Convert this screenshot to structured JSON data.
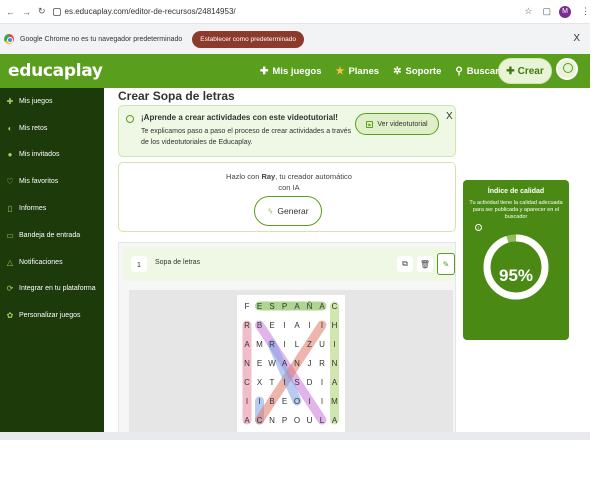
{
  "browser": {
    "url": "es.educaplay.com/editor-de-recursos/24814953/",
    "profile_initial": "M",
    "default_msg": "Google Chrome no es tu navegador predeterminado",
    "default_btn": "Establecer como predeterminado",
    "close": "X"
  },
  "header": {
    "logo": "educaplay",
    "nav": [
      {
        "label": "Mis juegos",
        "icon": "gamepad-icon"
      },
      {
        "label": "Planes",
        "icon": "star-icon"
      },
      {
        "label": "Soporte",
        "icon": "support-icon"
      },
      {
        "label": "Buscar juegos",
        "icon": "search-icon"
      }
    ],
    "create": "Crear"
  },
  "sidebar": {
    "items": [
      {
        "label": "Mis juegos",
        "icon": "gamepad-icon"
      },
      {
        "label": "Mis retos",
        "icon": "trophy-icon"
      },
      {
        "label": "Mis invitados",
        "icon": "users-icon"
      },
      {
        "label": "Mis favoritos",
        "icon": "heart-icon"
      },
      {
        "label": "Informes",
        "icon": "document-icon"
      },
      {
        "label": "Bandeja de entrada",
        "icon": "inbox-icon"
      },
      {
        "label": "Notificaciones",
        "icon": "bell-icon"
      },
      {
        "label": "Integrar en tu plataforma",
        "icon": "share-icon"
      },
      {
        "label": "Personalizar juegos",
        "icon": "settings-icon"
      }
    ]
  },
  "main": {
    "title": "Crear Sopa de letras",
    "tutorial": {
      "title": "¡Aprende a crear actividades con este videotutorial!",
      "text": "Te explicamos paso a paso el proceso de crear actividades a través de los videotutoriales de Educaplay.",
      "video_button": "Ver videotutorial",
      "close": "X"
    },
    "ray": {
      "text_prefix": "Hazlo con ",
      "name": "Ray",
      "text_suffix": ", tu creador automático con IA",
      "button": "Generar"
    },
    "editor": {
      "number": "1",
      "label": "Sopa de letras"
    },
    "grid_rows": [
      [
        "F",
        "E",
        "S",
        "P",
        "A",
        "Ñ",
        "A",
        "C"
      ],
      [
        "R",
        "B",
        "E",
        "I",
        "A",
        "I",
        "I",
        "H"
      ],
      [
        "A",
        "M",
        "R",
        "I",
        "L",
        "Z",
        "U",
        "I"
      ],
      [
        "N",
        "E",
        "W",
        "A",
        "N",
        "J",
        "R",
        "N"
      ],
      [
        "C",
        "X",
        "T",
        "I",
        "S",
        "D",
        "I",
        "A"
      ],
      [
        "I",
        "I",
        "B",
        "E",
        "O",
        "I",
        "I",
        "M"
      ],
      [
        "A",
        "C",
        "N",
        "P",
        "O",
        "U",
        "L",
        "A"
      ]
    ]
  },
  "quality": {
    "title": "Índice de calidad",
    "subtitle": "Tu actividad tiene la calidad adecuada para ser publicada y aparecer en el buscador",
    "percent": 95,
    "percent_label": "95%"
  }
}
